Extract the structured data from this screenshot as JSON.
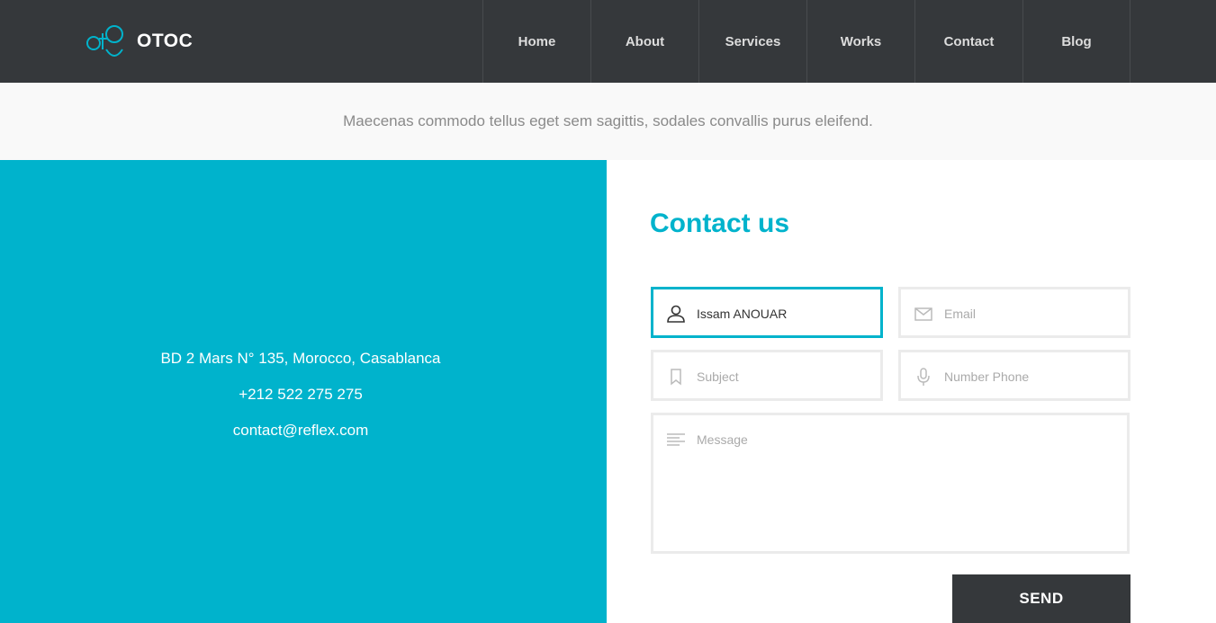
{
  "brand": {
    "name": "OTOC",
    "accent_color": "#00b3cc",
    "header_color": "#35383b"
  },
  "nav": {
    "items": [
      {
        "label": "Home"
      },
      {
        "label": "About"
      },
      {
        "label": "Services"
      },
      {
        "label": "Works"
      },
      {
        "label": "Contact"
      },
      {
        "label": "Blog"
      }
    ]
  },
  "band": {
    "text": "Maecenas commodo tellus eget sem sagittis, sodales convallis purus eleifend."
  },
  "info": {
    "address": "BD 2 Mars N° 135, Morocco, Casablanca",
    "phone": "+212 522 275 275",
    "email": "contact@reflex.com"
  },
  "form": {
    "title": "Contact us",
    "name": {
      "value": "Issam ANOUAR",
      "icon": "user-icon"
    },
    "email": {
      "placeholder": "Email",
      "icon": "envelope-icon"
    },
    "subject": {
      "placeholder": "Subject",
      "icon": "bookmark-icon"
    },
    "phone": {
      "placeholder": "Number Phone",
      "icon": "microphone-icon"
    },
    "message": {
      "placeholder": "Message",
      "icon": "text-lines-icon"
    },
    "send_label": "SEND"
  }
}
